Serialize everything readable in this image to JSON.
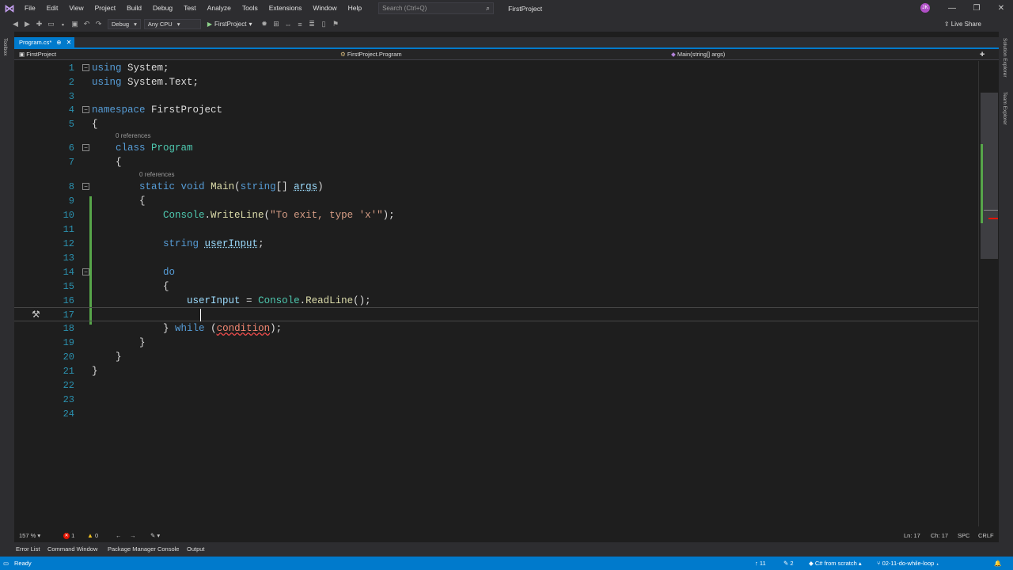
{
  "menu": [
    "File",
    "Edit",
    "View",
    "Project",
    "Build",
    "Debug",
    "Test",
    "Analyze",
    "Tools",
    "Extensions",
    "Window",
    "Help"
  ],
  "search": {
    "placeholder": "Search (Ctrl+Q)"
  },
  "title": "FirstProject",
  "avatar_initials": "JK",
  "toolbar": {
    "config": "Debug",
    "platform": "Any CPU",
    "run_target": "FirstProject",
    "live_share": "Live Share"
  },
  "left_strip_label": "Toolbox",
  "right_strip_labels": [
    "Solution Explorer",
    "Team Explorer"
  ],
  "tab": {
    "label": "Program.cs*",
    "pin": "⊕",
    "close": "✕"
  },
  "navbar": {
    "project": "FirstProject",
    "class": "FirstProject.Program",
    "member": "Main(string[] args)"
  },
  "code": {
    "refs_class": "0 references",
    "refs_main": "0 references",
    "lines": [
      {
        "n": "1"
      },
      {
        "n": "2"
      },
      {
        "n": "3"
      },
      {
        "n": "4"
      },
      {
        "n": "5"
      },
      {
        "n": "6"
      },
      {
        "n": "7"
      },
      {
        "n": "8"
      },
      {
        "n": "9"
      },
      {
        "n": "10"
      },
      {
        "n": "11"
      },
      {
        "n": "12"
      },
      {
        "n": "13"
      },
      {
        "n": "14"
      },
      {
        "n": "15"
      },
      {
        "n": "16"
      },
      {
        "n": "17"
      },
      {
        "n": "18"
      },
      {
        "n": "19"
      },
      {
        "n": "20"
      },
      {
        "n": "21"
      },
      {
        "n": "22"
      },
      {
        "n": "23"
      },
      {
        "n": "24"
      }
    ],
    "t": {
      "using": "using",
      "system": "System",
      "systemtext": "System.Text",
      "semi": ";",
      "namespace": "namespace",
      "ns_name": "FirstProject",
      "ob": "{",
      "cb": "}",
      "class": "class",
      "class_name": "Program",
      "static": "static",
      "void": "void",
      "main": "Main",
      "string": "string",
      "arr": "[] ",
      "args": "args",
      "console": "Console",
      "writeline": "WriteLine",
      "str_exit": "\"To exit, type 'x'\"",
      "userinput": "userInput",
      "do": "do",
      "readline": "ReadLine",
      "while": "while",
      "condition": "condition"
    }
  },
  "editor_status": {
    "zoom": "157 %",
    "errors": "1",
    "warnings": "0",
    "ln": "Ln: 17",
    "ch": "Ch: 17",
    "spc": "SPC",
    "crlf": "CRLF"
  },
  "tool_tabs": [
    "Error List",
    "Command Window",
    "Package Manager Console",
    "Output"
  ],
  "statusbar": {
    "ready": "Ready",
    "up_count": "11",
    "pencil_count": "2",
    "repo": "C# from scratch",
    "branch": "02-11-do-while-loop"
  }
}
